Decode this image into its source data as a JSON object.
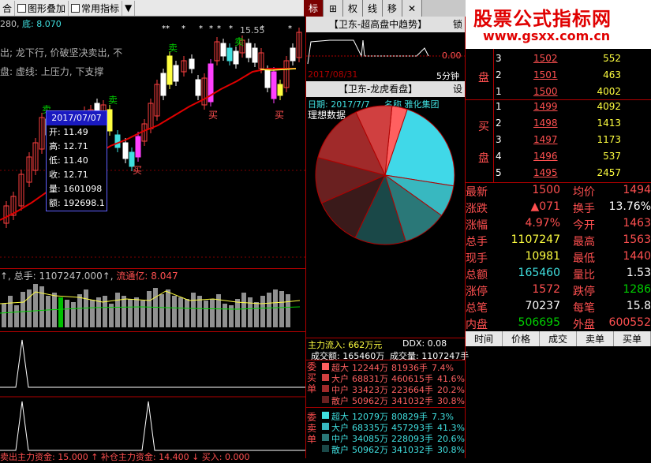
{
  "toolbar": {
    "item1": "合",
    "item2": "图形叠加",
    "item3": "常用指标",
    "arrow": "▼"
  },
  "tabs": [
    "标",
    "⊞",
    "权",
    "线",
    "移",
    "✕"
  ],
  "brand": {
    "title": "股票公式指标网",
    "url": "www.gsxx.com.cn"
  },
  "chart": {
    "top_left": "280,",
    "low_label": "底: 8.070",
    "high_label": "15.55",
    "text1": "出; 龙下行, 价破坚决卖出, 不",
    "text2": "盘: 虚线: 上压力, 下支撑",
    "buy": "买",
    "sell": "卖"
  },
  "tooltip": {
    "date": "2017/07/07",
    "open": "开: 11.49",
    "high": "高: 12.71",
    "low": "低: 11.40",
    "close": "收: 12.71",
    "vol": "量: 1601098",
    "amt": "额: 192698.1"
  },
  "volume": {
    "label1": "↑, 总手: 1107247.000↑,",
    "label2": "流通亿: 8.047"
  },
  "bottom": {
    "label": "卖出主力资金: 15.000 ↑ 补仓主力资金: 14.400 ↓ 买入: 0.000"
  },
  "trend": {
    "title": "【卫东-超高盘中趋势】",
    "lock": "锁",
    "value": "0.00",
    "date": "2017/08/31",
    "period": "5分钟"
  },
  "dragon": {
    "title": "【卫东-龙虎看盘】",
    "set": "设",
    "date": "日期: 2017/7/7",
    "name": "名称 雅化集团",
    "ideal": "理想数据"
  },
  "pie": {
    "colors": [
      "#ff6060",
      "#40d8e8",
      "#38b8c0",
      "#2a7878",
      "#1a4848",
      "#3a1a1a",
      "#6a2020",
      "#a02a2a",
      "#d04040"
    ],
    "shares": [
      3.6,
      22.3,
      7.4,
      10.3,
      11.9,
      11.3,
      10.7,
      14.0,
      8.5
    ]
  },
  "mainflow": {
    "inflow": "主力流入: 662万元",
    "ddx": "DDX: 0.08"
  },
  "deal": {
    "amt": "成交额: 165460万",
    "vol": "成交量: 1107247手"
  },
  "buy_orders": {
    "label": "委买单",
    "rows": [
      {
        "name": "超大",
        "amt": "12244万",
        "vol": "81936手",
        "pct": "7.4%"
      },
      {
        "name": "大户",
        "amt": "68831万",
        "vol": "460615手",
        "pct": "41.6%"
      },
      {
        "name": "中户",
        "amt": "33423万",
        "vol": "223664手",
        "pct": "20.2%"
      },
      {
        "name": "散户",
        "amt": "50962万",
        "vol": "341032手",
        "pct": "30.8%"
      }
    ]
  },
  "sell_orders": {
    "label": "委卖单",
    "rows": [
      {
        "name": "超大",
        "amt": "12079万",
        "vol": "80829手",
        "pct": "7.3%"
      },
      {
        "name": "大户",
        "amt": "68335万",
        "vol": "457293手",
        "pct": "41.3%"
      },
      {
        "name": "中户",
        "amt": "34085万",
        "vol": "228093手",
        "pct": "20.6%"
      },
      {
        "name": "散户",
        "amt": "50962万",
        "vol": "341032手",
        "pct": "30.8%"
      }
    ]
  },
  "orderbook": {
    "sell_label": "盘",
    "buy_label1": "买",
    "buy_label2": "盘",
    "sells": [
      {
        "n": "3",
        "p": "1502",
        "v": "552"
      },
      {
        "n": "2",
        "p": "1501",
        "v": "463"
      },
      {
        "n": "1",
        "p": "1500",
        "v": "4002"
      }
    ],
    "buys": [
      {
        "n": "1",
        "p": "1499",
        "v": "4092"
      },
      {
        "n": "2",
        "p": "1498",
        "v": "1413"
      },
      {
        "n": "3",
        "p": "1497",
        "v": "1173"
      },
      {
        "n": "4",
        "p": "1496",
        "v": "537"
      },
      {
        "n": "5",
        "p": "1495",
        "v": "2457"
      }
    ]
  },
  "stats": [
    {
      "l1": "最新",
      "v1": "1500",
      "l2": "均价",
      "v2": "1494"
    },
    {
      "l1": "涨跌",
      "v1": "▲071",
      "l2": "换手",
      "v2": "13.76%"
    },
    {
      "l1": "涨幅",
      "v1": "4.97%",
      "l2": "今开",
      "v2": "1463"
    },
    {
      "l1": "总手",
      "v1": "1107247",
      "l2": "最高",
      "v2": "1563"
    },
    {
      "l1": "现手",
      "v1": "10981",
      "l2": "最低",
      "v2": "1440"
    },
    {
      "l1": "总额",
      "v1": "165460",
      "l2": "量比",
      "v2": "1.53"
    },
    {
      "l1": "涨停",
      "v1": "1572",
      "l2": "跌停",
      "v2": "1286"
    },
    {
      "l1": "总笔",
      "v1": "70237",
      "l2": "每笔",
      "v2": "15.8"
    },
    {
      "l1": "内盘",
      "v1": "506695",
      "l2": "外盘",
      "v2": "600552"
    }
  ],
  "txheader": [
    "时间",
    "价格",
    "成交",
    "卖单",
    "买单"
  ]
}
